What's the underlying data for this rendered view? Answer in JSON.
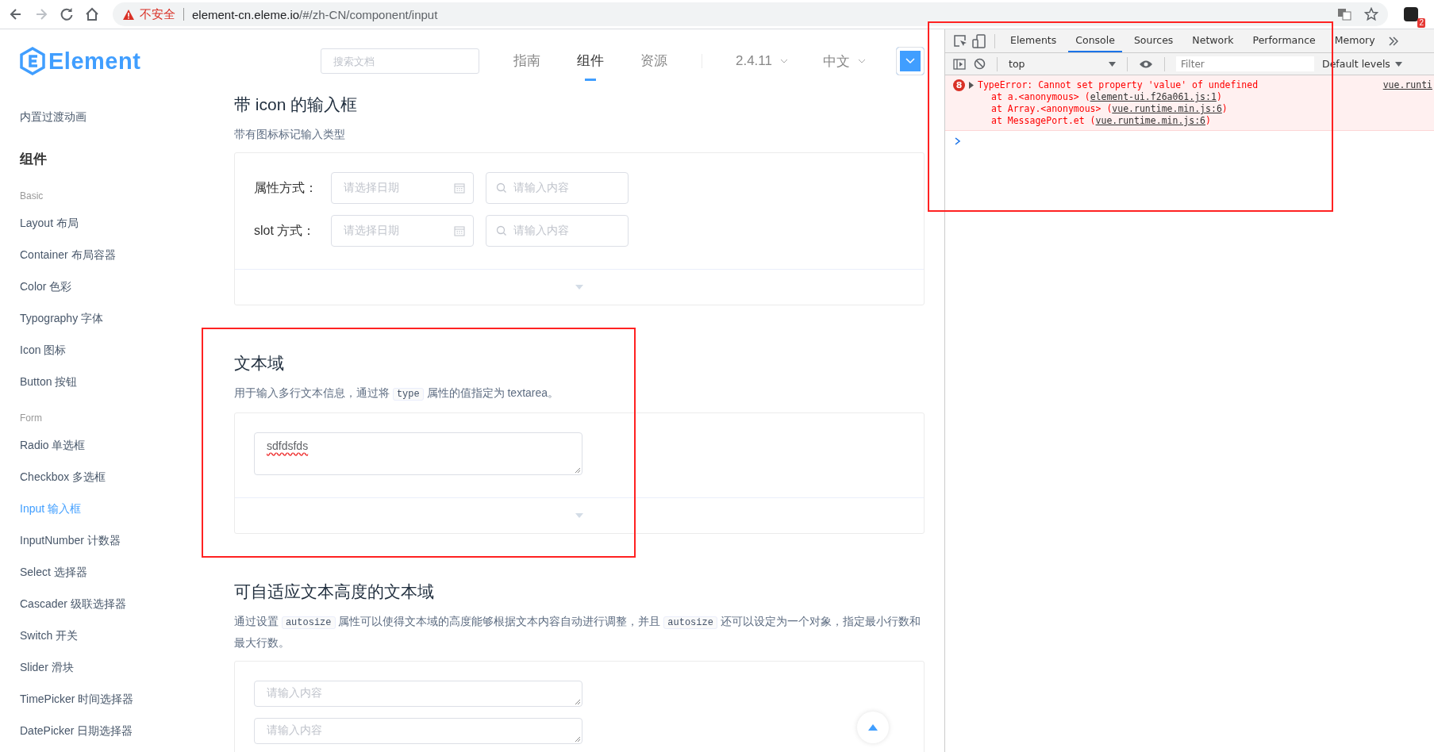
{
  "browser": {
    "warning": "不安全",
    "url_host": "element-cn.eleme.io",
    "url_path": "/#/zh-CN/component/input",
    "extension_badge": "2"
  },
  "header": {
    "logo": "Element",
    "search": {
      "placeholder": "搜索文档"
    },
    "nav": [
      {
        "label": "指南",
        "selected": false
      },
      {
        "label": "组件",
        "selected": true
      },
      {
        "label": "资源",
        "selected": false
      }
    ],
    "version": "2.4.11",
    "language": "中文"
  },
  "sidebar": {
    "items": [
      {
        "kind": "link",
        "label": "内置过渡动画",
        "selected": false
      },
      {
        "kind": "group",
        "label": "组件"
      },
      {
        "kind": "category",
        "label": "Basic"
      },
      {
        "kind": "link",
        "label": "Layout 布局",
        "selected": false
      },
      {
        "kind": "link",
        "label": "Container 布局容器",
        "selected": false
      },
      {
        "kind": "link",
        "label": "Color 色彩",
        "selected": false
      },
      {
        "kind": "link",
        "label": "Typography 字体",
        "selected": false
      },
      {
        "kind": "link",
        "label": "Icon 图标",
        "selected": false
      },
      {
        "kind": "link",
        "label": "Button 按钮",
        "selected": false
      },
      {
        "kind": "category",
        "label": "Form"
      },
      {
        "kind": "link",
        "label": "Radio 单选框",
        "selected": false
      },
      {
        "kind": "link",
        "label": "Checkbox 多选框",
        "selected": false
      },
      {
        "kind": "link",
        "label": "Input 输入框",
        "selected": true
      },
      {
        "kind": "link",
        "label": "InputNumber 计数器",
        "selected": false
      },
      {
        "kind": "link",
        "label": "Select 选择器",
        "selected": false
      },
      {
        "kind": "link",
        "label": "Cascader 级联选择器",
        "selected": false
      },
      {
        "kind": "link",
        "label": "Switch 开关",
        "selected": false
      },
      {
        "kind": "link",
        "label": "Slider 滑块",
        "selected": false
      },
      {
        "kind": "link",
        "label": "TimePicker 时间选择器",
        "selected": false
      },
      {
        "kind": "link",
        "label": "DatePicker 日期选择器",
        "selected": false
      }
    ]
  },
  "sections": [
    {
      "title": "带 icon 的输入框",
      "description": [
        {
          "kind": "text",
          "text": "带有图标标记输入类型"
        }
      ],
      "demo": {
        "kind": "icon-inputs",
        "rows": [
          {
            "label": "属性方式：",
            "date_placeholder": "请选择日期",
            "search_placeholder": "请输入内容"
          },
          {
            "label": "slot 方式：",
            "date_placeholder": "请选择日期",
            "search_placeholder": "请输入内容"
          }
        ]
      }
    },
    {
      "title": "文本域",
      "description": [
        {
          "kind": "text",
          "text": "用于输入多行文本信息，通过将 "
        },
        {
          "kind": "code",
          "text": "type"
        },
        {
          "kind": "text",
          "text": " 属性的值指定为 textarea。"
        }
      ],
      "highlighted": true,
      "demo": {
        "kind": "textareas",
        "fields": [
          {
            "value": "sdfdsfds"
          }
        ]
      }
    },
    {
      "title": "可自适应文本高度的文本域",
      "description": [
        {
          "kind": "text",
          "text": "通过设置 "
        },
        {
          "kind": "code",
          "text": "autosize"
        },
        {
          "kind": "text",
          "text": " 属性可以使得文本域的高度能够根据文本内容自动进行调整，并且 "
        },
        {
          "kind": "code",
          "text": "autosize"
        },
        {
          "kind": "text",
          "text": " 还可以设定为一个对象，指定最小行数和最大行数。"
        }
      ],
      "demo": {
        "kind": "textareas",
        "fields": [
          {
            "placeholder": "请输入内容"
          },
          {
            "placeholder": "请输入内容"
          }
        ]
      }
    }
  ],
  "devtools": {
    "highlighted": true,
    "tabs": [
      {
        "label": "Elements",
        "selected": false
      },
      {
        "label": "Console",
        "selected": true
      },
      {
        "label": "Sources",
        "selected": false
      },
      {
        "label": "Network",
        "selected": false
      },
      {
        "label": "Performance",
        "selected": false
      },
      {
        "label": "Memory",
        "selected": false
      }
    ],
    "context": "top",
    "filter": {
      "placeholder": "Filter"
    },
    "levels": "Default levels",
    "messages": [
      {
        "kind": "error",
        "count": "8",
        "text": "TypeError: Cannot set property 'value' of undefined",
        "source": "vue.runti",
        "stack": [
          {
            "prefix": "at a.<anonymous> (",
            "link": "element-ui.f26a061.js:1",
            "suffix": ")"
          },
          {
            "prefix": "at Array.<anonymous> (",
            "link": "vue.runtime.min.js:6",
            "suffix": ")"
          },
          {
            "prefix": "at MessagePort.et (",
            "link": "vue.runtime.min.js:6",
            "suffix": ")"
          }
        ]
      }
    ]
  }
}
